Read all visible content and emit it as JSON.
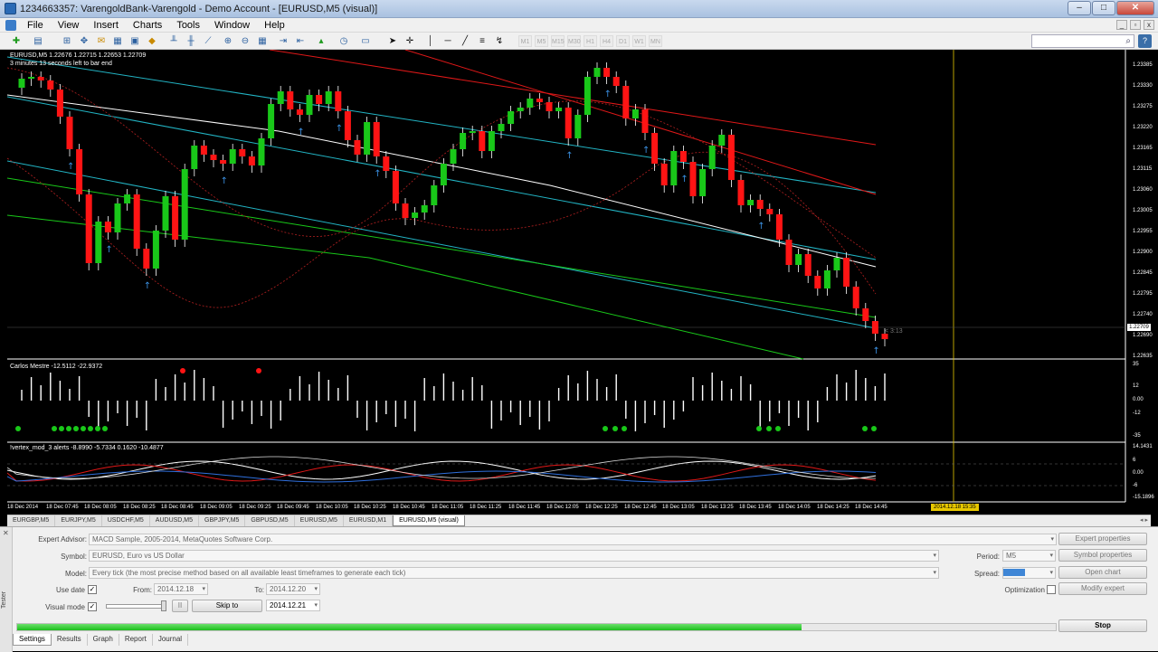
{
  "window": {
    "title": "1234663357: VarengoldBank-Varengold - Demo Account - [EURUSD,M5 (visual)]",
    "controls": [
      "–",
      "□",
      "✕"
    ]
  },
  "menu": [
    "File",
    "View",
    "Insert",
    "Charts",
    "Tools",
    "Window",
    "Help"
  ],
  "toolbar": {
    "timeframes": [
      "M1",
      "M5",
      "M15",
      "M30",
      "H1",
      "H4",
      "D1",
      "W1",
      "MN"
    ]
  },
  "chart": {
    "symbol_info": "EURUSD,M5  1.22676 1.22715 1.22653 1.22709",
    "timer_text": "3 minutes 13 seconds left to bar end",
    "bar_countdown": "< 3:13",
    "price_labels": [
      "1.23385",
      "1.23330",
      "1.23275",
      "1.23220",
      "1.23165",
      "1.23115",
      "1.23060",
      "1.23005",
      "1.22955",
      "1.22900",
      "1.22845",
      "1.22795",
      "1.22740",
      "1.22690",
      "1.22635"
    ],
    "current_price": "1.22709",
    "indicator1": {
      "name": "Carlos Mestre -12.5112 -22.9372",
      "scale": [
        "35",
        "12",
        "0.00",
        "-12",
        "-35"
      ]
    },
    "indicator2": {
      "name": "!vertex_mod_3 alerts -8.8990 -5.7334 0.1620 -10.4877",
      "scale": [
        "14.1431",
        "6",
        "0.00",
        "-6",
        "-15.1896"
      ]
    },
    "time_labels": [
      "18 Dec 2014",
      "18 Dec 07:45",
      "18 Dec 08:05",
      "18 Dec 08:25",
      "18 Dec 08:45",
      "18 Dec 09:05",
      "18 Dec 09:25",
      "18 Dec 09:45",
      "18 Dec 10:05",
      "18 Dec 10:25",
      "18 Dec 10:45",
      "18 Dec 11:05",
      "18 Dec 11:25",
      "18 Dec 11:45",
      "18 Dec 12:05",
      "18 Dec 12:25",
      "18 Dec 12:45",
      "18 Dec 13:05",
      "18 Dec 13:25",
      "18 Dec 13:45",
      "18 Dec 14:05",
      "18 Dec 14:25",
      "18 Dec 14:45"
    ],
    "time_cursor": "2014.12.18 15:35",
    "colors": {
      "bull": "#19c819",
      "bear": "#ff1414",
      "arrow": "#3a8fe0"
    }
  },
  "chart_tabs": {
    "items": [
      "EURGBP,M5",
      "EURJPY,M5",
      "USDCHF,M5",
      "AUDUSD,M5",
      "GBPJPY,M5",
      "GBPUSD,M5",
      "EURUSD,M5",
      "EURUSD,M1",
      "EURUSD,M5 (visual)"
    ],
    "active_index": 8
  },
  "tester": {
    "side_title": "Tester",
    "expert_label": "Expert Advisor:",
    "expert_value": "MACD Sample, 2005-2014, MetaQuotes Software Corp.",
    "symbol_label": "Symbol:",
    "symbol_value": "EURUSD, Euro vs US Dollar",
    "model_label": "Model:",
    "model_value": "Every tick (the most precise method based on all available least timeframes to generate each tick)",
    "use_date_label": "Use date",
    "from_label": "From:",
    "from_value": "2014.12.18",
    "to_label": "To:",
    "to_value": "2014.12.20",
    "visual_mode_label": "Visual mode",
    "skip_to_label": "Skip to",
    "skip_to_value": "2014.12.21",
    "pause_label": "II",
    "period_label": "Period:",
    "period_value": "M5",
    "spread_label": "Spread:",
    "optimization_label": "Optimization",
    "buttons": {
      "expert_properties": "Expert properties",
      "symbol_properties": "Symbol properties",
      "open_chart": "Open chart",
      "modify_expert": "Modify expert",
      "stop": "Stop"
    },
    "progress": 0.755,
    "tabs": [
      "Settings",
      "Results",
      "Graph",
      "Report",
      "Journal"
    ],
    "active_tab_index": 0
  }
}
